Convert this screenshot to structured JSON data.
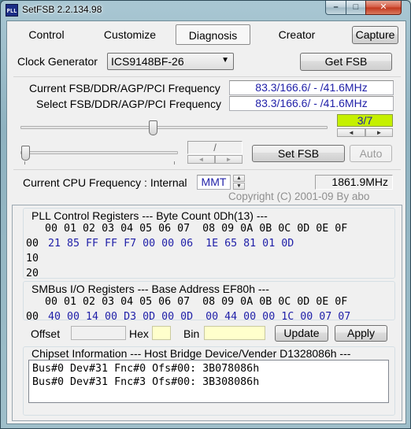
{
  "window": {
    "title": "SetFSB 2.2.134.98",
    "icon_text": "PLL",
    "controls": {
      "minimize": "–",
      "maximize": "□",
      "close": "✕"
    }
  },
  "tabs": [
    {
      "label": "Control",
      "active": false
    },
    {
      "label": "Customize",
      "active": false
    },
    {
      "label": "Diagnosis",
      "active": true
    },
    {
      "label": "Creator",
      "active": false
    }
  ],
  "capture_label": "Capture",
  "clock_generator": {
    "label": "Clock Generator",
    "value": "ICS9148BF-26"
  },
  "get_fsb_label": "Get FSB",
  "current_freq": {
    "label": "Current FSB/DDR/AGP/PCI Frequency",
    "value": "83.3/166.6/ - /41.6MHz"
  },
  "select_freq": {
    "label": "Select FSB/DDR/AGP/PCI Frequency",
    "value": "83.3/166.6/ - /41.6MHz"
  },
  "slider_main": {
    "position_index": 3,
    "count": 7,
    "fraction": 0.43
  },
  "position_readout": "3/7",
  "slider_secondary": {
    "fraction": 0.0
  },
  "secondary_readout": "/",
  "set_fsb_label": "Set FSB",
  "auto_label": "Auto",
  "cpu": {
    "label": "Current CPU Frequency : Internal",
    "mode": "MMT",
    "value": "1861.9MHz"
  },
  "copyright": "Copyright (C) 2001-09 By abo",
  "pll": {
    "title": "PLL Control Registers  --- Byte Count 0Dh(13) ---",
    "header": "   00 01 02 03 04 05 06 07  08 09 0A 0B 0C 0D 0E 0F",
    "rows": [
      {
        "addr": "00",
        "bytes": "21 85 FF FF F7 00 00 06  1E 65 81 01 0D"
      },
      {
        "addr": "10",
        "bytes": ""
      },
      {
        "addr": "20",
        "bytes": ""
      }
    ]
  },
  "smbus": {
    "title": "SMBus I/O Registers  --- Base Address EF80h ---",
    "header": "   00 01 02 03 04 05 06 07  08 09 0A 0B 0C 0D 0E 0F",
    "rows": [
      {
        "addr": "00",
        "bytes": "40 00 14 00 D3 0D 00 0D  00 44 00 00 1C 00 07 07"
      }
    ]
  },
  "offset_label": "Offset",
  "hex_label": "Hex",
  "bin_label": "Bin",
  "update_label": "Update",
  "apply_label": "Apply",
  "chipset": {
    "title": "Chipset Information  --- Host Bridge Device/Vender D1328086h ---",
    "lines": [
      "Bus#0 Dev#31 Fnc#0 Ofs#00: 3B078086h",
      "Bus#0 Dev#31 Fnc#3 Ofs#00: 3B308086h"
    ]
  },
  "colors": {
    "value_text": "#1f1fa8",
    "position_readout_bg": "#c5f000",
    "hex_field_bg": "#ffffcc",
    "bin_field_bg": "#ffffcc"
  }
}
